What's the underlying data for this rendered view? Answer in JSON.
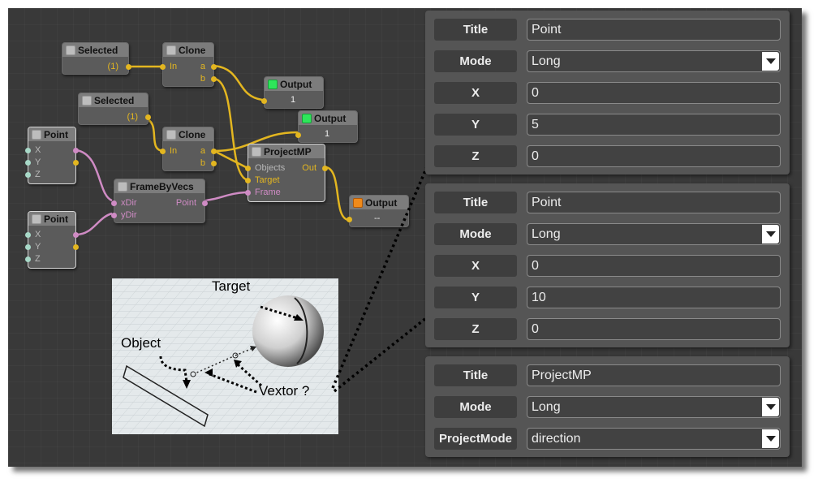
{
  "graph": {
    "selected1": {
      "title": "Selected",
      "out": "(1)"
    },
    "clone1": {
      "title": "Clone",
      "in": "In",
      "a": "a",
      "b": "b"
    },
    "output1": {
      "title": "Output",
      "value": "1"
    },
    "selected2": {
      "title": "Selected",
      "out": "(1)"
    },
    "output2": {
      "title": "Output",
      "value": "1"
    },
    "point1": {
      "title": "Point",
      "x": "X",
      "y": "Y",
      "z": "Z"
    },
    "clone2": {
      "title": "Clone",
      "in": "In",
      "a": "a",
      "b": "b"
    },
    "projectmp": {
      "title": "ProjectMP",
      "objects": "Objects",
      "target": "Target",
      "frame": "Frame",
      "out": "Out"
    },
    "framebyvecs": {
      "title": "FrameByVecs",
      "xdir": "xDir",
      "ydir": "yDir",
      "point": "Point"
    },
    "output3": {
      "title": "Output",
      "value": "--"
    },
    "point2": {
      "title": "Point",
      "x": "X",
      "y": "Y",
      "z": "Z"
    },
    "colors": {
      "gold": "#e3b620",
      "pink": "#cf8bc4",
      "mint": "#a8d9c8",
      "active_output": "#2ee65a",
      "inactive_output": "#f08a1a"
    }
  },
  "annotations": {
    "target": "Target",
    "object": "Object",
    "vector": "Vextor ?"
  },
  "panels": [
    {
      "rows": [
        {
          "label": "Title",
          "value": "Point",
          "type": "text"
        },
        {
          "label": "Mode",
          "value": "Long",
          "type": "select"
        },
        {
          "label": "X",
          "value": "0",
          "type": "text"
        },
        {
          "label": "Y",
          "value": "5",
          "type": "text"
        },
        {
          "label": "Z",
          "value": "0",
          "type": "text"
        }
      ]
    },
    {
      "rows": [
        {
          "label": "Title",
          "value": "Point",
          "type": "text"
        },
        {
          "label": "Mode",
          "value": "Long",
          "type": "select"
        },
        {
          "label": "X",
          "value": "0",
          "type": "text"
        },
        {
          "label": "Y",
          "value": "10",
          "type": "text"
        },
        {
          "label": "Z",
          "value": "0",
          "type": "text"
        }
      ]
    },
    {
      "rows": [
        {
          "label": "Title",
          "value": "ProjectMP",
          "type": "text"
        },
        {
          "label": "Mode",
          "value": "Long",
          "type": "select"
        },
        {
          "label": "ProjectMode",
          "value": "direction",
          "type": "select"
        }
      ]
    }
  ]
}
